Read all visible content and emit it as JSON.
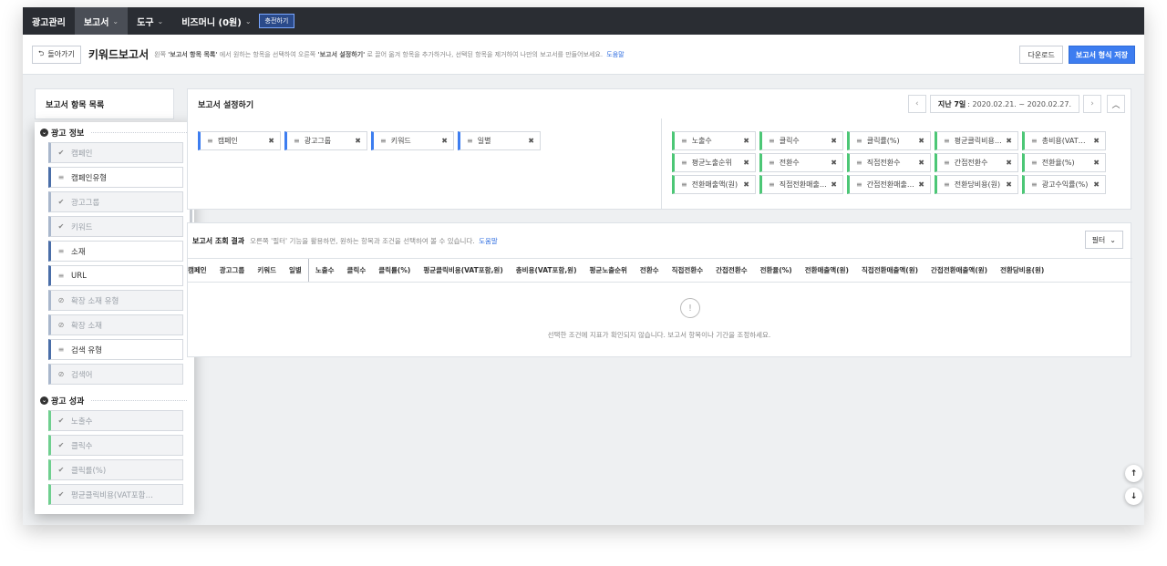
{
  "topnav": {
    "brand": "광고관리",
    "items": [
      {
        "label": "보고서",
        "active": true
      },
      {
        "label": "도구",
        "active": false
      },
      {
        "label": "비즈머니 (0원)",
        "active": false
      }
    ],
    "charge_label": "충전하기"
  },
  "header": {
    "back_label": "돌아가기",
    "title": "키워드보고서",
    "desc_1": "왼쪽",
    "desc_b1": "'보고서 항목 목록'",
    "desc_2": "에서 원하는 항목을 선택하여 오른쪽",
    "desc_b2": "'보고서 설정하기'",
    "desc_3": "로 끌어 옮겨 항목을 추가하거나, 선택된 항목을 제거하여 나만의 보고서를 만들어보세요.",
    "help_label": "도움말",
    "download_label": "다운로드",
    "save_format_label": "보고서 형식 저장"
  },
  "left_panel": {
    "title": "보고서 항목 목록",
    "group1_title": "광고 정보",
    "group1_items": [
      {
        "label": "캠페인",
        "icon": "check",
        "state": "selected"
      },
      {
        "label": "캠페인유형",
        "icon": "bars",
        "state": "available"
      },
      {
        "label": "광고그룹",
        "icon": "check",
        "state": "selected"
      },
      {
        "label": "키워드",
        "icon": "check",
        "state": "selected"
      },
      {
        "label": "소재",
        "icon": "bars",
        "state": "available"
      },
      {
        "label": "URL",
        "icon": "bars",
        "state": "available"
      },
      {
        "label": "확장 소재 유형",
        "icon": "ban",
        "state": "disabled"
      },
      {
        "label": "확장 소재",
        "icon": "ban",
        "state": "disabled"
      },
      {
        "label": "검색 유형",
        "icon": "bars",
        "state": "available"
      },
      {
        "label": "검색어",
        "icon": "ban",
        "state": "disabled"
      }
    ],
    "group2_title": "광고 성과",
    "group2_items": [
      {
        "label": "노출수",
        "icon": "check"
      },
      {
        "label": "클릭수",
        "icon": "check"
      },
      {
        "label": "클릭률(%)",
        "icon": "check"
      },
      {
        "label": "평균클릭비용(VAT포함…",
        "icon": "check"
      }
    ]
  },
  "settings": {
    "title": "보고서 설정하기",
    "date_label": "지난 7일",
    "date_range": ": 2020.02.21. ~ 2020.02.27.",
    "left_chips": [
      "캠페인",
      "광고그룹",
      "키워드",
      "일별"
    ],
    "right_chips": [
      [
        "노출수",
        "클릭수",
        "클릭률(%)",
        "평균클릭비용…",
        "총비용(VAT…"
      ],
      [
        "평균노출순위",
        "전환수",
        "직접전환수",
        "간접전환수",
        "전환율(%)"
      ],
      [
        "전환매출액(원)",
        "직접전환매출…",
        "간접전환매출…",
        "전환당비용(원)",
        "광고수익률(%)"
      ]
    ]
  },
  "results": {
    "title": "보고서 조회 결과",
    "desc": "오른쪽 '필터' 기능을 활용하면, 원하는 항목과 조건을 선택하여 볼 수 있습니다.",
    "help_label": "도움말",
    "filter_label": "필터",
    "columns": [
      "캠페인",
      "광고그룹",
      "키워드",
      "일별",
      "노출수",
      "클릭수",
      "클릭률(%)",
      "평균클릭비용(VAT포함,원)",
      "총비용(VAT포함,원)",
      "평균노출순위",
      "전환수",
      "직접전환수",
      "간접전환수",
      "전환율(%)",
      "전환매출액(원)",
      "직접전환매출액(원)",
      "간접전환매출액(원)",
      "전환당비용(원)"
    ],
    "empty_message": "선택한 조건에 지표가 확인되지 않습니다. 보고서 항목이나 기간을 조정하세요."
  },
  "colors": {
    "accent_blue": "#3d7df0",
    "metric_green": "#4cc776",
    "nav_dark": "#2a2d33"
  }
}
